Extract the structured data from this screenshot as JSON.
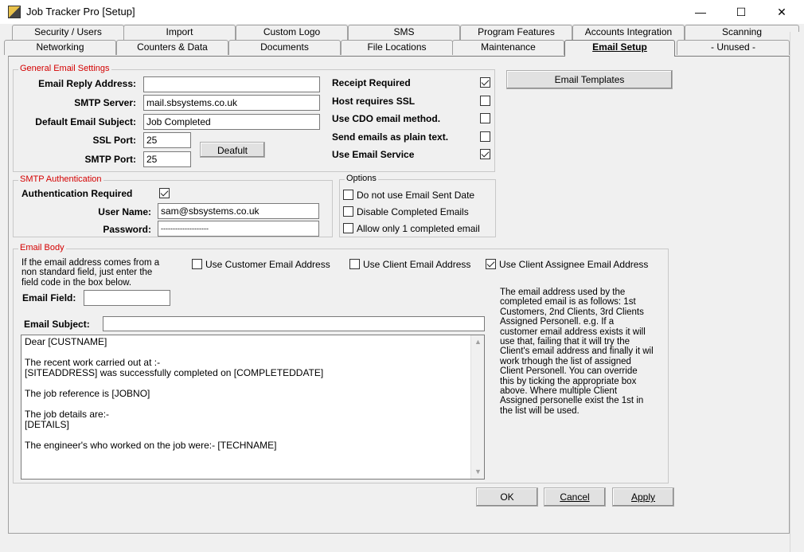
{
  "window": {
    "title": "Job Tracker Pro [Setup]",
    "minimize": "—",
    "maximize": "☐",
    "close": "✕"
  },
  "tabs_row1": [
    "Security / Users",
    "Import",
    "Custom Logo",
    "SMS",
    "Program Features",
    "Accounts Integration",
    "Scanning"
  ],
  "tabs_row2": [
    "Networking",
    "Counters & Data",
    "Documents",
    "File Locations",
    "Maintenance",
    "Email Setup",
    "- Unused -"
  ],
  "active_tab": "Email Setup",
  "general": {
    "title": "General Email Settings",
    "reply_label": "Email Reply Address:",
    "reply_value": "",
    "smtp_server_label": "SMTP Server:",
    "smtp_server_value": "mail.sbsystems.co.uk",
    "subject_label": "Default Email Subject:",
    "subject_value": "Job Completed",
    "ssl_port_label": "SSL Port:",
    "ssl_port_value": "25",
    "smtp_port_label": "SMTP Port:",
    "smtp_port_value": "25",
    "default_button": "Deafult",
    "receipt_label": "Receipt Required",
    "receipt_checked": true,
    "ssl_label": "Host requires SSL",
    "ssl_checked": false,
    "cdo_label": "Use CDO email method.",
    "cdo_checked": false,
    "plain_label": "Send emails as plain text.",
    "plain_checked": false,
    "service_label": "Use Email Service",
    "service_checked": true
  },
  "templates_button": "Email Templates",
  "auth": {
    "title": "SMTP Authentication",
    "required_label": "Authentication Required",
    "required_checked": true,
    "user_label": "User Name:",
    "user_value": "sam@sbsystems.co.uk",
    "password_label": "Password:",
    "password_value": "--------------------"
  },
  "options": {
    "title": "Options",
    "items": [
      {
        "label": "Do not use Email Sent Date",
        "checked": false
      },
      {
        "label": "Disable Completed Emails",
        "checked": false
      },
      {
        "label": "Allow only 1 completed email",
        "checked": false
      }
    ]
  },
  "email_body": {
    "title": "Email Body",
    "hint_lines": [
      "If the email address comes from a",
      "non standard field, just enter the",
      "field code in the box below."
    ],
    "use_customer": {
      "label": "Use Customer Email Address",
      "checked": false
    },
    "use_client": {
      "label": "Use Client Email Address",
      "checked": false
    },
    "use_assignee": {
      "label": "Use Client Assignee Email Address",
      "checked": true
    },
    "field_label": "Email Field:",
    "field_value": "",
    "subject_label": "Email Subject:",
    "subject_value": "",
    "body_lines": [
      "Dear [CUSTNAME]",
      "",
      "The recent work carried out at :-",
      "[SITEADDRESS] was successfully completed on [COMPLETEDDATE]",
      "",
      "The job reference is [JOBNO]",
      "",
      "The job details are:-",
      "[DETAILS]",
      "",
      "The engineer's who worked on the job were:- [TECHNAME]"
    ],
    "info_lines": [
      "The email address used by the",
      "completed email is as follows: 1st",
      "Customers, 2nd Clients, 3rd Clients",
      "Assigned Personell.  e.g. If a",
      "customer email address exists it will",
      "use that, failing that it will try the",
      "Client's email address and finally it wil",
      "work trhough the list of assigned",
      "Client Personell.  You can override",
      "this by ticking the appropriate box",
      "above.  Where multiple Client",
      "Assigned personelle exist the 1st in",
      "the list will be used."
    ]
  },
  "buttons": {
    "ok": "OK",
    "cancel": "Cancel",
    "apply": "Apply"
  }
}
